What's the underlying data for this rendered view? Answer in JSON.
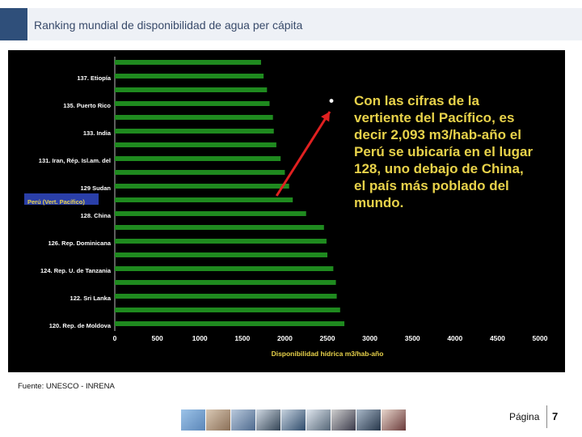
{
  "header": {
    "title": "Ranking mundial de disponibilidad de agua per cápita"
  },
  "footer": {
    "source": "Fuente:  UNESCO - INRENA",
    "page_label": "Página",
    "page_number": "7"
  },
  "annotation": {
    "bullet": "•",
    "lines": [
      "Con las cifras de la",
      "vertiente del Pacífico, es",
      "decir 2,093 m3/hab-año el",
      "Perú se ubicaría en el lugar",
      "128, uno debajo de China,",
      "el país más poblado del",
      "mundo."
    ]
  },
  "colors": {
    "bar": "#1f8a1f",
    "background": "#000000",
    "highlight": "#2a3fa8",
    "arrow": "#e02020",
    "annotation_text": "#e8d24a"
  },
  "thumbnails": [
    "water-drop",
    "hands",
    "fish",
    "pylons",
    "bridge",
    "city",
    "people",
    "crowd",
    "eye"
  ],
  "chart_data": {
    "type": "bar",
    "orientation": "horizontal",
    "xlabel": "Disponibilidad hídrica m3/hab-año",
    "xlim": [
      0,
      5000
    ],
    "xticks": [
      "0",
      "500",
      "1000",
      "1500",
      "2000",
      "2500",
      "3000",
      "3500",
      "4000",
      "4500",
      "5000"
    ],
    "bars": [
      {
        "label": "",
        "value": 1720
      },
      {
        "label": "137. Etiopía",
        "value": 1750
      },
      {
        "label": "",
        "value": 1790
      },
      {
        "label": "135. Puerto Rico",
        "value": 1820
      },
      {
        "label": "",
        "value": 1860
      },
      {
        "label": "133. India",
        "value": 1870
      },
      {
        "label": "",
        "value": 1900
      },
      {
        "label": "131. Iran, Rép. Isl.am. del",
        "value": 1950
      },
      {
        "label": "",
        "value": 2000
      },
      {
        "label": "129 Sudan",
        "value": 2050
      },
      {
        "label": "Perú (Vert. Pacífico)",
        "value": 2093,
        "highlight": true
      },
      {
        "label": "128. China",
        "value": 2250
      },
      {
        "label": "",
        "value": 2460
      },
      {
        "label": "126. Rep. Dominicana",
        "value": 2490
      },
      {
        "label": "",
        "value": 2500
      },
      {
        "label": "124. Rep. U. de Tanzania",
        "value": 2570
      },
      {
        "label": "",
        "value": 2600
      },
      {
        "label": "122. Sri Lanka",
        "value": 2610
      },
      {
        "label": "",
        "value": 2650
      },
      {
        "label": "120. Rep. de Moldova",
        "value": 2700
      }
    ]
  }
}
